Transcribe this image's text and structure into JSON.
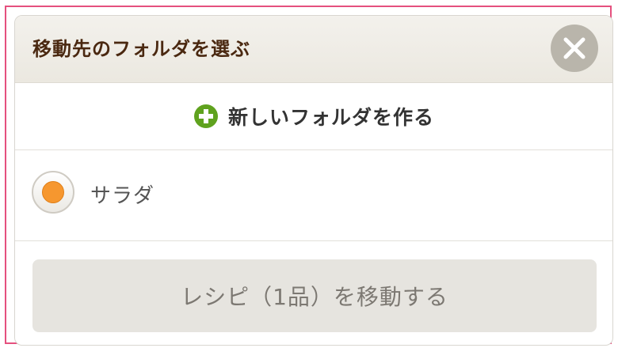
{
  "dialog": {
    "title": "移動先のフォルダを選ぶ",
    "close_icon": "close-x-icon"
  },
  "new_folder": {
    "icon": "plus-circle-icon",
    "label": "新しいフォルダを作る",
    "icon_color": "#5fa21e"
  },
  "folders": [
    {
      "name": "サラダ",
      "selected": true
    }
  ],
  "move_button": {
    "label": "レシピ（1品）を移動する",
    "enabled": false
  },
  "colors": {
    "frame_border": "#e5507e",
    "title": "#4a2810",
    "radio_selected": "#f6972f",
    "close_button": "#b9b5ab",
    "move_button_bg": "#e6e4df"
  }
}
